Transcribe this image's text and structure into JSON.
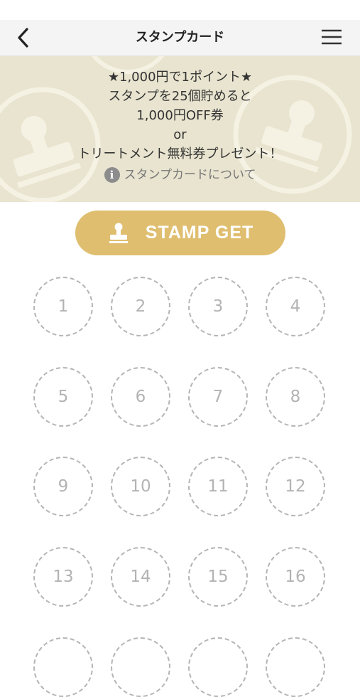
{
  "header": {
    "title": "スタンプカード"
  },
  "banner": {
    "lines": [
      "★1,000円で1ポイント★",
      "スタンプを25個貯めると",
      "1,000円OFF券",
      "or",
      "トリートメント無料券プレゼント！"
    ],
    "about_link": "スタンプカードについて"
  },
  "stamp_button": {
    "label": "STAMP GET"
  },
  "stamps": [
    "1",
    "2",
    "3",
    "4",
    "5",
    "6",
    "7",
    "8",
    "9",
    "10",
    "11",
    "12",
    "13",
    "14",
    "15",
    "16"
  ],
  "colors": {
    "accent": "#dfbe70",
    "banner_bg": "#e8e4cf",
    "stamp_border": "#b5b5b5"
  }
}
